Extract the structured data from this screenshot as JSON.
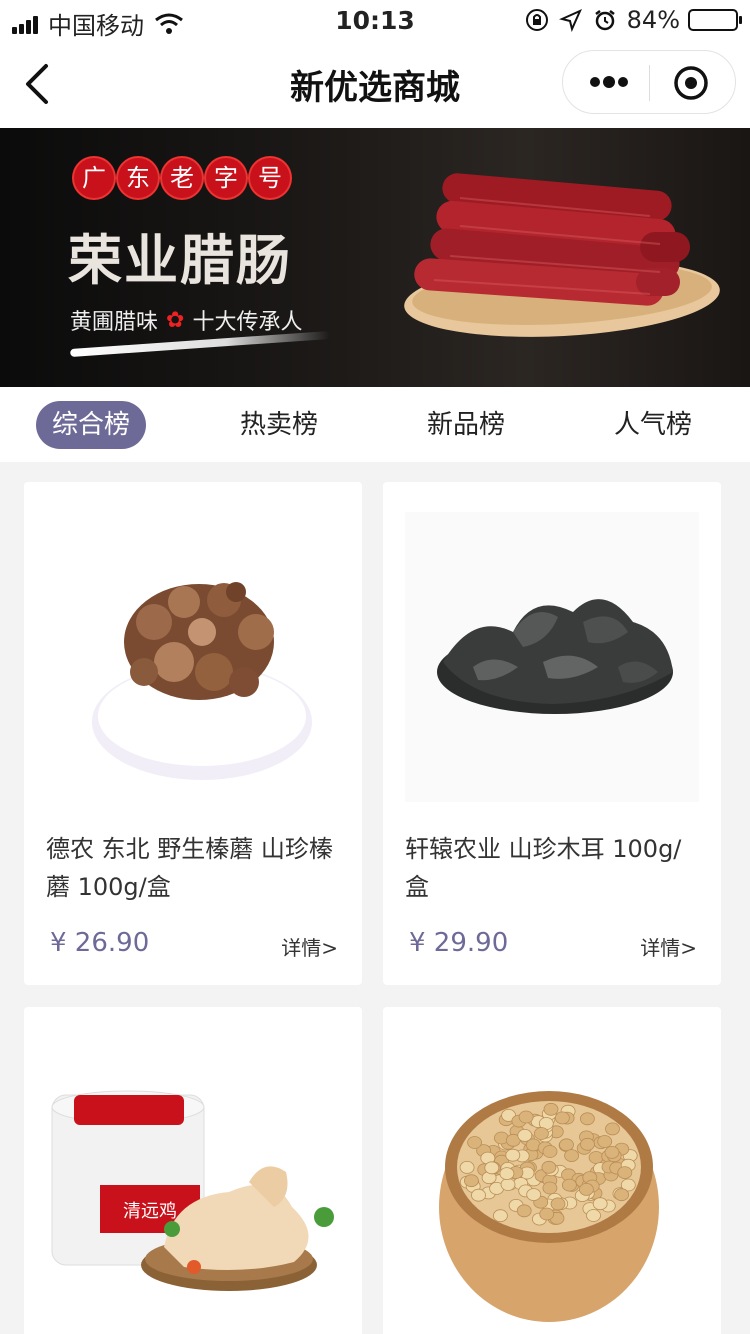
{
  "status_bar": {
    "carrier": "中国移动",
    "time": "10:13",
    "battery": "84%",
    "battery_level": 0.84
  },
  "nav": {
    "title": "新优选商城"
  },
  "banner": {
    "badges": [
      "广",
      "东",
      "老",
      "字",
      "号"
    ],
    "title": "荣业腊肠",
    "sub_left": "黄圃腊味",
    "sub_right": "十大传承人"
  },
  "tabs": [
    {
      "label": "综合榜",
      "active": true
    },
    {
      "label": "热卖榜",
      "active": false
    },
    {
      "label": "新品榜",
      "active": false
    },
    {
      "label": "人气榜",
      "active": false
    }
  ],
  "products": [
    {
      "name": "德农 东北 野生榛蘑 山珍榛蘑 100g/盒",
      "price": "¥ 26.90",
      "detail": "详情>",
      "image": "dried-mushroom"
    },
    {
      "name": "轩辕农业 山珍木耳 100g/盒",
      "price": "¥ 29.90",
      "detail": "详情>",
      "image": "black-fungus"
    },
    {
      "name": "",
      "price": "",
      "detail": "",
      "image": "chicken-with-box",
      "box_label": "清远鸡"
    },
    {
      "name": "",
      "price": "",
      "detail": "",
      "image": "soybeans-bowl"
    }
  ],
  "colors": {
    "accent": "#6e6a98",
    "badge_red": "#c8111a"
  }
}
